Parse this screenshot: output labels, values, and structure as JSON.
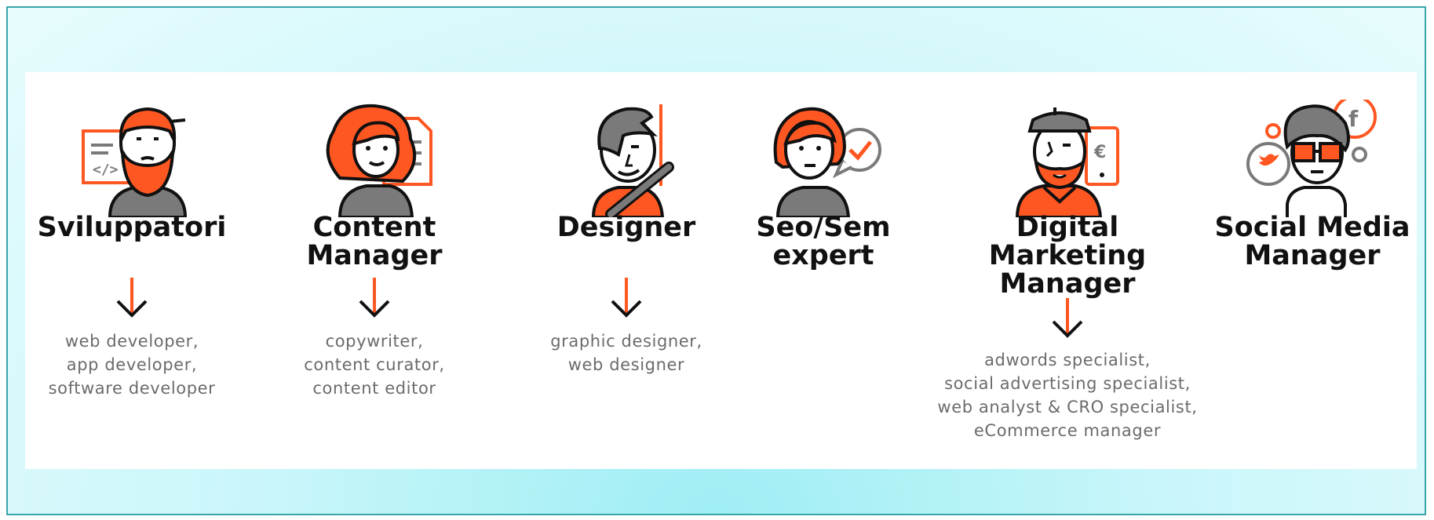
{
  "colors": {
    "accent": "#ff5722",
    "gray": "#7a7a7a",
    "ink": "#111111",
    "roles": "#6b6b6b"
  },
  "profiles": [
    {
      "title": "Sviluppatori",
      "roles": "web developer,\napp developer,\nsoftware developer",
      "icon": "developer-avatar-icon"
    },
    {
      "title": "Content Manager",
      "roles": "copywriter,\ncontent curator,\ncontent editor",
      "icon": "content-manager-avatar-icon"
    },
    {
      "title": "Designer",
      "roles": "graphic designer,\nweb designer",
      "icon": "designer-avatar-icon"
    },
    {
      "title": "Seo/Sem\nexpert",
      "roles": "",
      "icon": "seo-sem-avatar-icon"
    },
    {
      "title": "Digital Marketing\nManager",
      "roles": "adwords specialist,\nsocial advertising specialist,\nweb analyst & CRO specialist,\neCommerce manager",
      "icon": "marketing-manager-avatar-icon"
    },
    {
      "title": "Social Media\nManager",
      "roles": "",
      "icon": "social-media-avatar-icon"
    }
  ]
}
